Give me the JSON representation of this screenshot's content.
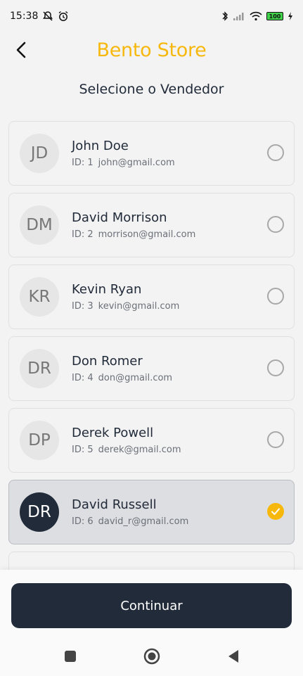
{
  "status_bar": {
    "time": "15:38",
    "left_icons": [
      "mute-icon",
      "alarm-icon"
    ],
    "right_icons": [
      "bluetooth-icon",
      "signal-icon",
      "wifi-icon",
      "battery-icon"
    ],
    "battery_level": "100"
  },
  "header": {
    "title": "Bento Store",
    "back_icon": "chevron-left-icon"
  },
  "subtitle": "Selecione o Vendedor",
  "sellers": [
    {
      "initials": "JD",
      "name": "John Doe",
      "id": "ID: 1",
      "email": "john@gmail.com",
      "selected": false
    },
    {
      "initials": "DM",
      "name": "David Morrison",
      "id": "ID: 2",
      "email": "morrison@gmail.com",
      "selected": false
    },
    {
      "initials": "KR",
      "name": "Kevin Ryan",
      "id": "ID: 3",
      "email": "kevin@gmail.com",
      "selected": false
    },
    {
      "initials": "DR",
      "name": "Don Romer",
      "id": "ID: 4",
      "email": "don@gmail.com",
      "selected": false
    },
    {
      "initials": "DP",
      "name": "Derek Powell",
      "id": "ID: 5",
      "email": "derek@gmail.com",
      "selected": false
    },
    {
      "initials": "DR",
      "name": "David Russell",
      "id": "ID: 6",
      "email": "david_r@gmail.com",
      "selected": true
    }
  ],
  "continue_label": "Continuar",
  "nav_icons": [
    "square-icon",
    "home-circle-icon",
    "back-triangle-icon"
  ],
  "colors": {
    "accent": "#f7b80e",
    "primary_dark": "#222b3a",
    "background": "#f3f3f3"
  }
}
